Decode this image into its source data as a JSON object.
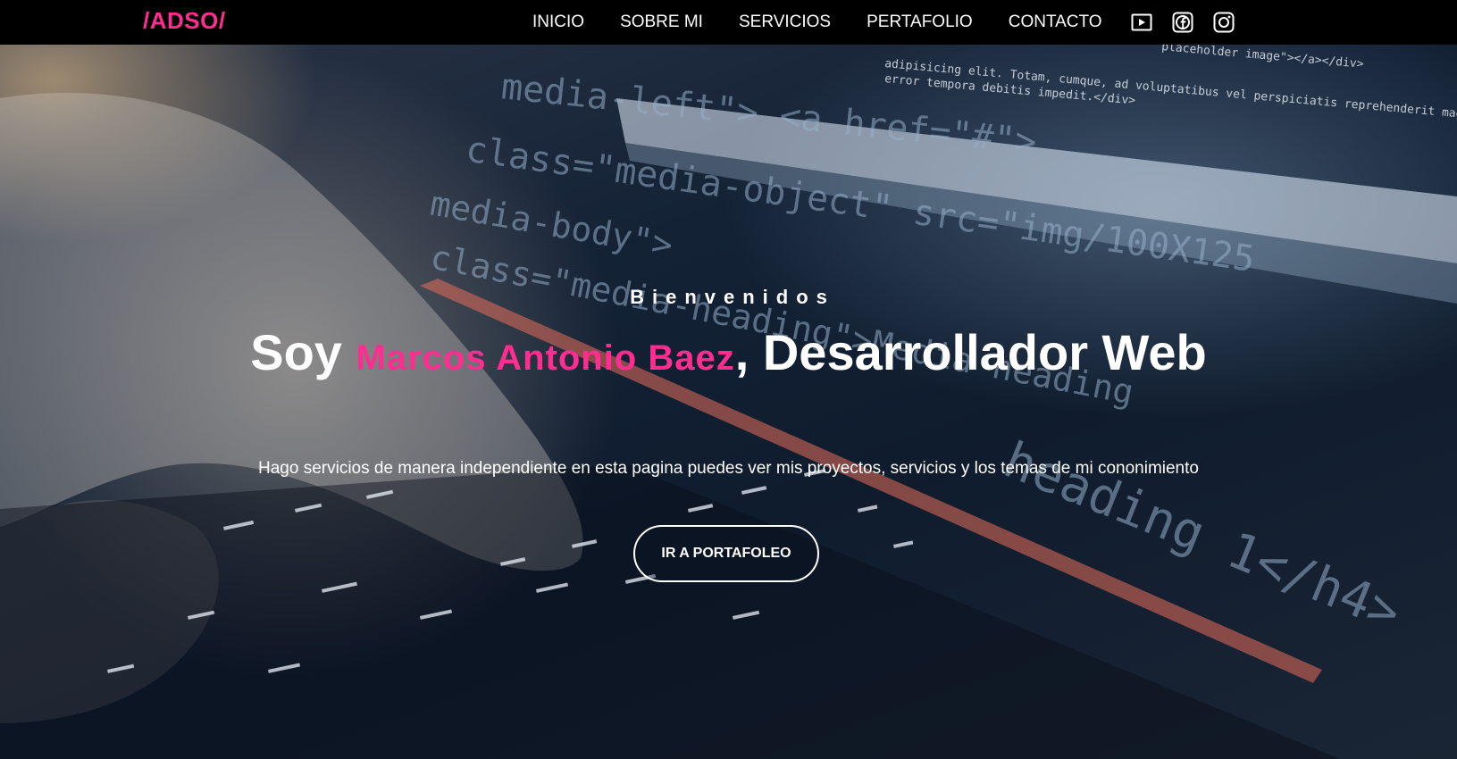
{
  "navbar": {
    "brand": "/ADSO/",
    "links": [
      "INICIO",
      "SOBRE MI",
      "SERVICIOS",
      "PERTAFOLIO",
      "CONTACTO"
    ],
    "icons": [
      "youtube-icon",
      "facebook-icon",
      "instagram-icon"
    ]
  },
  "hero": {
    "eyebrow": "Bienvenidos",
    "title_prefix": "Soy ",
    "name": "Marcos Antonio Baez",
    "title_suffix": ", Desarrollador Web",
    "description": "Hago servicios de manera independiente en esta pagina puedes ver mis proyectos, servicios y los temas de mi cononimiento",
    "button_label": "IR A PORTAFOLEO",
    "background_code": {
      "line1": "media-left\"> <a href=\"#\">",
      "line2": "class=\"media-object\" src=\"img/100X125",
      "line3": "media-body\">",
      "line4": "class=\"media-heading\">Media heading",
      "line5": "heading 1</h4>",
      "snippet1": "adipisicing elit. Totam, cumque, ad voluptatibus vel perspiciatis reprehenderit magni",
      "snippet2": "error tempora debitis impedit.</div>",
      "snippet3": "placeholder image\"></a></div>"
    }
  },
  "colors": {
    "accent": "#ff2d8f",
    "navbar": "#000000",
    "text": "#ffffff"
  }
}
